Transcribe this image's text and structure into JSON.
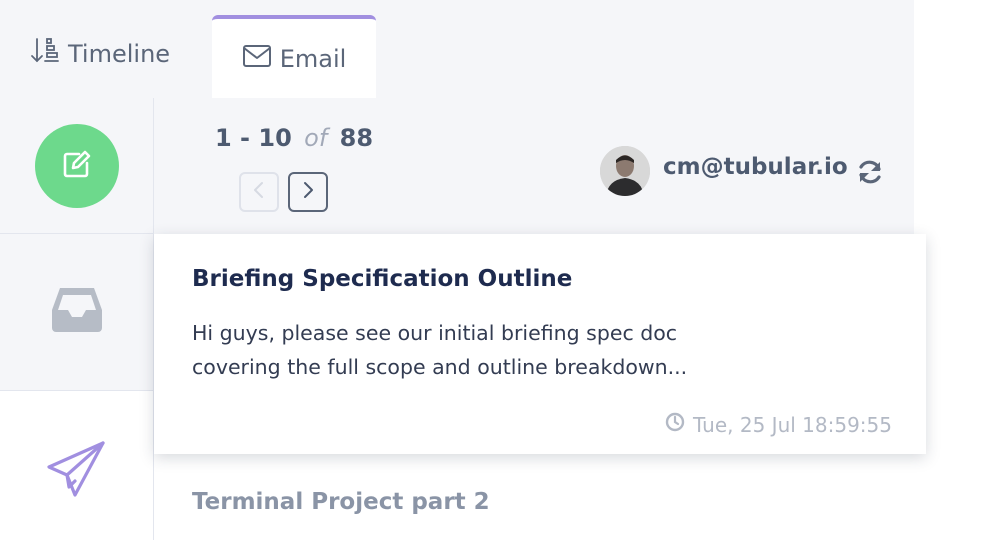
{
  "tabs": {
    "timeline": {
      "label": "Timeline",
      "icon": "sort-descending-icon"
    },
    "email": {
      "label": "Email",
      "icon": "envelope-icon",
      "active": true
    }
  },
  "sidebar": {
    "compose": {
      "icon": "compose-icon",
      "color": "#6dd98c"
    },
    "inbox": {
      "icon": "inbox-tray-icon"
    },
    "sent": {
      "icon": "paper-plane-icon",
      "color": "#a18fe0"
    }
  },
  "pager": {
    "range": "1 - 10",
    "of": "of",
    "total": "88"
  },
  "account": {
    "email": "cm@tubular.io"
  },
  "emails": [
    {
      "subject": "Briefing Specification Outline",
      "preview_line1": "Hi guys, please see our initial briefing spec doc",
      "preview_line2": "covering the full scope and outline breakdown...",
      "time": "Tue, 25 Jul 18:59:55"
    },
    {
      "subject": "Terminal Project part 2"
    }
  ],
  "colors": {
    "accent": "#a18fe0",
    "compose": "#6dd98c",
    "text_dark": "#1e2b4f"
  }
}
